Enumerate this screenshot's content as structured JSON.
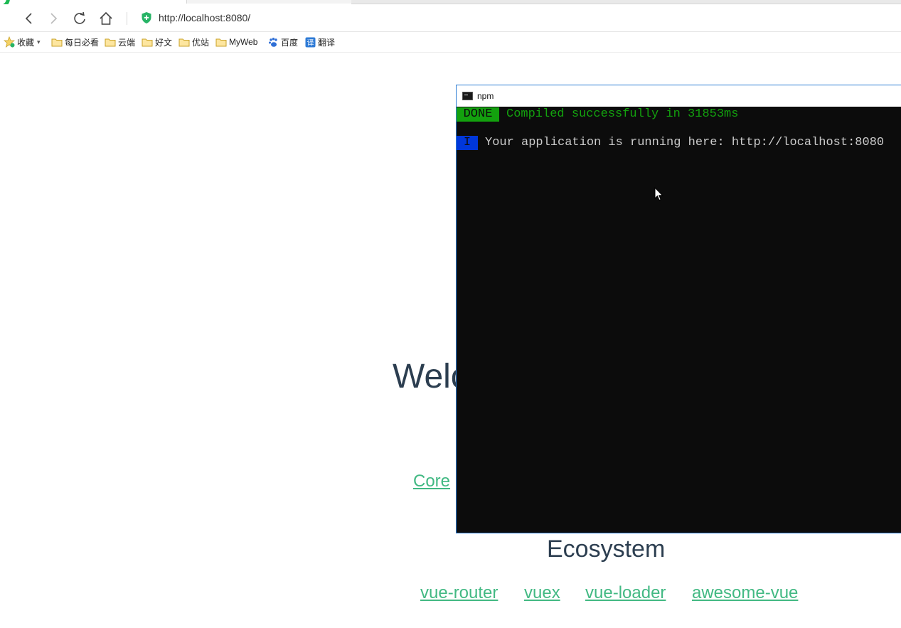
{
  "browser": {
    "url": "http://localhost:8080/",
    "bookmarks": [
      {
        "label": "收藏",
        "icon": "star-icon"
      },
      {
        "label": "每日必看",
        "icon": "folder-icon"
      },
      {
        "label": "云端",
        "icon": "folder-icon"
      },
      {
        "label": "好文",
        "icon": "folder-icon"
      },
      {
        "label": "优站",
        "icon": "folder-icon"
      },
      {
        "label": "MyWeb",
        "icon": "folder-icon"
      },
      {
        "label": "百度",
        "icon": "baidu-paw-icon"
      },
      {
        "label": "翻译",
        "icon": "translate-icon"
      }
    ]
  },
  "page": {
    "welcome_partial": "Welc",
    "core_link_partial": "Core",
    "ecosystem_title": "Ecosystem",
    "ecosystem_links": [
      "vue-router",
      "vuex",
      "vue-loader",
      "awesome-vue"
    ],
    "link_color": "#42b983",
    "text_color": "#2c3e50"
  },
  "console": {
    "title": "npm",
    "done_badge": "DONE",
    "done_message": "Compiled successfully in 31853ms",
    "info_badge": "I",
    "info_message": "Your application is running here: http://localhost:8080",
    "done_color": "#13a10e",
    "info_color": "#0037da"
  }
}
